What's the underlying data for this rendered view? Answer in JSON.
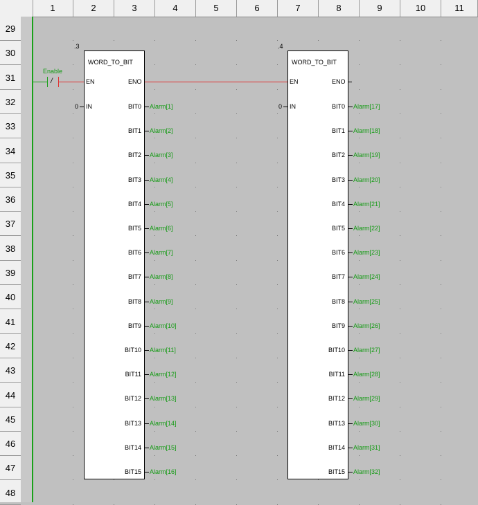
{
  "columns": [
    "1",
    "2",
    "3",
    "4",
    "5",
    "6",
    "7",
    "8",
    "9",
    "10",
    "11"
  ],
  "rows": [
    "29",
    "30",
    "31",
    "32",
    "33",
    "34",
    "35",
    "36",
    "37",
    "38",
    "39",
    "40",
    "41",
    "42",
    "43",
    "44",
    "45",
    "46",
    "47",
    "48"
  ],
  "contact": {
    "label": "Enable",
    "symbol": "/"
  },
  "blocks": [
    {
      "tag": ".3",
      "name": "WORD_TO_BIT",
      "en": "EN",
      "eno": "ENO",
      "in_label": "IN",
      "in_value": "0",
      "outputs": [
        "BIT0",
        "BIT1",
        "BIT2",
        "BIT3",
        "BIT4",
        "BIT5",
        "BIT6",
        "BIT7",
        "BIT8",
        "BIT9",
        "BIT10",
        "BIT11",
        "BIT12",
        "BIT13",
        "BIT14",
        "BIT15"
      ],
      "vars": [
        "Alarm[1]",
        "Alarm[2]",
        "Alarm[3]",
        "Alarm[4]",
        "Alarm[5]",
        "Alarm[6]",
        "Alarm[7]",
        "Alarm[8]",
        "Alarm[9]",
        "Alarm[10]",
        "Alarm[11]",
        "Alarm[12]",
        "Alarm[13]",
        "Alarm[14]",
        "Alarm[15]",
        "Alarm[16]"
      ]
    },
    {
      "tag": ".4",
      "name": "WORD_TO_BIT",
      "en": "EN",
      "eno": "ENO",
      "in_label": "IN",
      "in_value": "0",
      "outputs": [
        "BIT0",
        "BIT1",
        "BIT2",
        "BIT3",
        "BIT4",
        "BIT5",
        "BIT6",
        "BIT7",
        "BIT8",
        "BIT9",
        "BIT10",
        "BIT11",
        "BIT12",
        "BIT13",
        "BIT14",
        "BIT15"
      ],
      "vars": [
        "Alarm[17]",
        "Alarm[18]",
        "Alarm[19]",
        "Alarm[20]",
        "Alarm[21]",
        "Alarm[22]",
        "Alarm[23]",
        "Alarm[24]",
        "Alarm[25]",
        "Alarm[26]",
        "Alarm[27]",
        "Alarm[28]",
        "Alarm[29]",
        "Alarm[30]",
        "Alarm[31]",
        "Alarm[32]"
      ]
    }
  ],
  "colors": {
    "rail": "#1aa11a",
    "power_flow": "#e03030",
    "variable": "#139a13"
  }
}
